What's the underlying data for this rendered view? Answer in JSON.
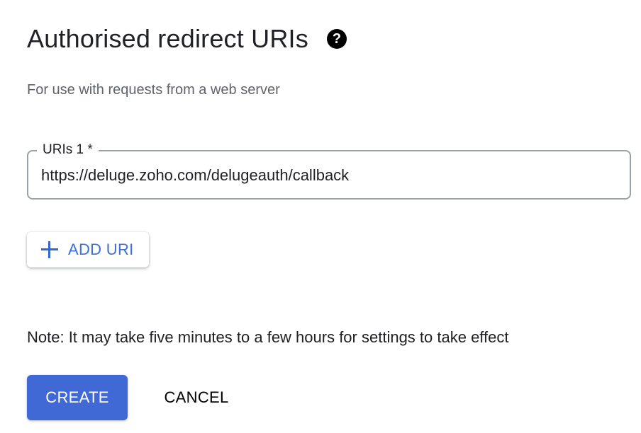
{
  "section": {
    "title": "Authorised redirect URIs",
    "help_icon_glyph": "?",
    "subtitle": "For use with requests from a web server"
  },
  "uri_field": {
    "label": "URIs 1 *",
    "value": "https://deluge.zoho.com/delugeauth/callback"
  },
  "add_uri_button": {
    "label": "ADD URI",
    "icon": "plus-icon"
  },
  "note": "Note: It may take five minutes to a few hours for settings to take effect",
  "actions": {
    "create_label": "CREATE",
    "cancel_label": "CANCEL"
  },
  "colors": {
    "primary": "#4169d6",
    "link": "#3c6fd8",
    "border": "#9aa0a6",
    "muted_text": "#5f6368"
  }
}
